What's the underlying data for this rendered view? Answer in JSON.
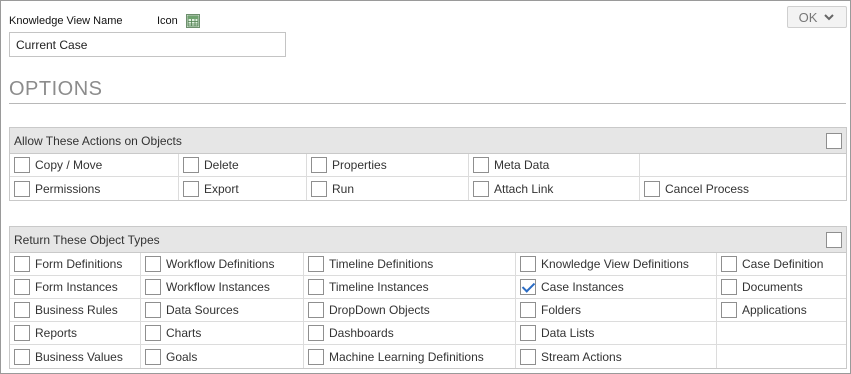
{
  "header": {
    "view_name_label": "Knowledge View Name",
    "icon_label": "Icon",
    "view_name_value": "Current Case",
    "ok_label": "OK"
  },
  "options_heading": "OPTIONS",
  "actions_section": {
    "title": "Allow These Actions on Objects",
    "rows": [
      [
        {
          "label": "Copy / Move",
          "checked": false
        },
        {
          "label": "Delete",
          "checked": false
        },
        {
          "label": "Properties",
          "checked": false
        },
        {
          "label": "Meta Data",
          "checked": false
        },
        null
      ],
      [
        {
          "label": "Permissions",
          "checked": false
        },
        {
          "label": "Export",
          "checked": false
        },
        {
          "label": "Run",
          "checked": false
        },
        {
          "label": "Attach Link",
          "checked": false
        },
        {
          "label": "Cancel Process",
          "checked": false
        }
      ]
    ]
  },
  "types_section": {
    "title": "Return These Object Types",
    "rows": [
      [
        {
          "label": "Form Definitions",
          "checked": false
        },
        {
          "label": "Workflow Definitions",
          "checked": false
        },
        {
          "label": "Timeline Definitions",
          "checked": false
        },
        {
          "label": "Knowledge View Definitions",
          "checked": false
        },
        {
          "label": "Case Definition",
          "checked": false
        }
      ],
      [
        {
          "label": "Form Instances",
          "checked": false
        },
        {
          "label": "Workflow Instances",
          "checked": false
        },
        {
          "label": "Timeline Instances",
          "checked": false
        },
        {
          "label": "Case Instances",
          "checked": true
        },
        {
          "label": "Documents",
          "checked": false
        }
      ],
      [
        {
          "label": "Business Rules",
          "checked": false
        },
        {
          "label": "Data Sources",
          "checked": false
        },
        {
          "label": "DropDown Objects",
          "checked": false
        },
        {
          "label": "Folders",
          "checked": false
        },
        {
          "label": "Applications",
          "checked": false
        }
      ],
      [
        {
          "label": "Reports",
          "checked": false
        },
        {
          "label": "Charts",
          "checked": false
        },
        {
          "label": "Dashboards",
          "checked": false
        },
        {
          "label": "Data Lists",
          "checked": false
        },
        null
      ],
      [
        {
          "label": "Business Values",
          "checked": false
        },
        {
          "label": "Goals",
          "checked": false
        },
        {
          "label": "Machine Learning Definitions",
          "checked": false
        },
        {
          "label": "Stream Actions",
          "checked": false
        },
        null
      ]
    ]
  },
  "colors": {
    "section_header_bg": "#e6e6e6",
    "check_mark": "#2b6cc4",
    "heading": "#8c8c8c"
  },
  "icons": {
    "icon_picker": "table-icon",
    "ok_dropdown": "chevron-down-icon"
  }
}
